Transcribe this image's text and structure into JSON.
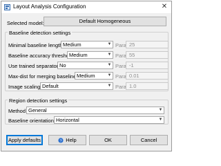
{
  "window": {
    "title": "Layout Analysis Configuration",
    "close_glyph": "✕"
  },
  "model": {
    "label": "Selected model:",
    "value": "Default Homogeneous"
  },
  "baseline": {
    "title": "Baseline detection settings",
    "param_label": "Param-Value:",
    "rows": [
      {
        "label": "Minimal baseline length",
        "value": "Medium",
        "param": "25"
      },
      {
        "label": "Baseline accuracy threshold",
        "value": "Medium",
        "param": "55"
      },
      {
        "label": "Use trained separators",
        "value": "No",
        "param": "-1"
      },
      {
        "label": "Max-dist for merging baselines",
        "value": "Medium",
        "param": "0.01"
      },
      {
        "label": "Image scaling",
        "value": "Default",
        "param": "1.0"
      }
    ]
  },
  "region": {
    "title": "Region detection settings",
    "method_label": "Method",
    "method_value": "General",
    "orientation_label": "Baseline orientation",
    "orientation_value": "Horizontal"
  },
  "buttons": {
    "apply_defaults": "Apply defaults",
    "help": "Help",
    "ok": "OK",
    "cancel": "Cancel"
  },
  "icons": {
    "app": "layout-window-icon",
    "help": "help-icon"
  },
  "colors": {
    "accent": "#0078d7",
    "window_bg": "#f0f0f0"
  }
}
